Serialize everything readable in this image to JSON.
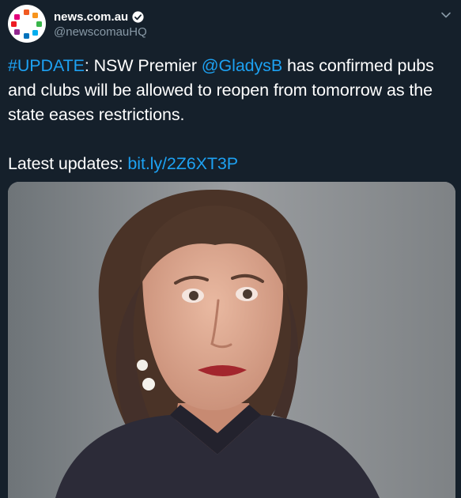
{
  "account": {
    "display_name": "news.com.au",
    "handle": "@newscomauHQ",
    "avatar_icon": "newscomau-dots-logo",
    "verified_icon": "verified-badge-icon"
  },
  "menu": {
    "icon": "chevron-down-icon"
  },
  "tweet": {
    "hashtag": "#UPDATE",
    "text_a": ": NSW Premier ",
    "mention": "@GladysB",
    "text_b": " has confirmed pubs and clubs will be allowed to reopen from tomorrow as the state eases restrictions.",
    "link_lead": "Latest updates: ",
    "link": "bit.ly/2Z6XT3P"
  },
  "media": {
    "description_icon": "photo"
  },
  "colors": {
    "background": "#15202b",
    "link": "#1da1f2",
    "secondary_text": "#8899a6"
  }
}
